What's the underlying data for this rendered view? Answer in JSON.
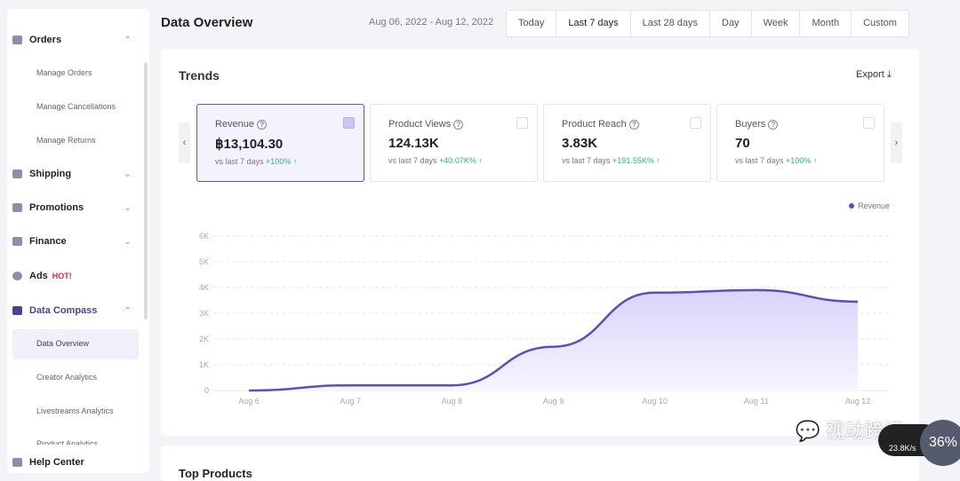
{
  "sidebar": {
    "orders": "Orders",
    "manage_orders": "Manage Orders",
    "manage_cancellations": "Manage Cancellations",
    "manage_returns": "Manage Returns",
    "shipping": "Shipping",
    "promotions": "Promotions",
    "finance": "Finance",
    "ads": "Ads",
    "hot": "HOT!",
    "data_compass": "Data Compass",
    "data_overview": "Data Overview",
    "creator_analytics": "Creator Analytics",
    "livestreams_analytics": "Livestreams Analytics",
    "product_analytics": "Product Analytics",
    "help_center": "Help Center"
  },
  "header": {
    "title": "Data Overview",
    "date_range": "Aug 06, 2022 - Aug 12, 2022",
    "tabs": [
      "Today",
      "Last 7 days",
      "Last 28 days",
      "Day",
      "Week",
      "Month",
      "Custom"
    ],
    "active_tab": "Last 7 days"
  },
  "trends": {
    "title": "Trends",
    "export": "Export",
    "metrics": [
      {
        "label": "Revenue",
        "value": "฿13,104.30",
        "compare": "vs last 7 days",
        "change": "+100%",
        "selected": true
      },
      {
        "label": "Product Views",
        "value": "124.13K",
        "compare": "vs last 7 days",
        "change": "+40.07K%",
        "selected": false
      },
      {
        "label": "Product Reach",
        "value": "3.83K",
        "compare": "vs last 7 days",
        "change": "+191.55K%",
        "selected": false
      },
      {
        "label": "Buyers",
        "value": "70",
        "compare": "vs last 7 days",
        "change": "+100%",
        "selected": false
      }
    ]
  },
  "next_section": "Top Products",
  "overlay": {
    "watermark": "视动跨境",
    "speed": "23.8K/s",
    "gauge": "36%"
  },
  "chart_data": {
    "type": "area",
    "categories": [
      "Aug 6",
      "Aug 7",
      "Aug 8",
      "Aug 9",
      "Aug 10",
      "Aug 11",
      "Aug 12"
    ],
    "series": [
      {
        "name": "Revenue",
        "values": [
          0,
          200,
          200,
          1700,
          3800,
          3900,
          3450
        ],
        "color": "#5b4fb8"
      }
    ],
    "ylim": [
      0,
      6000
    ],
    "yticks": [
      "0",
      "1K",
      "2K",
      "3K",
      "4K",
      "5K",
      "6K"
    ],
    "grid": true,
    "legend": "top-right"
  }
}
